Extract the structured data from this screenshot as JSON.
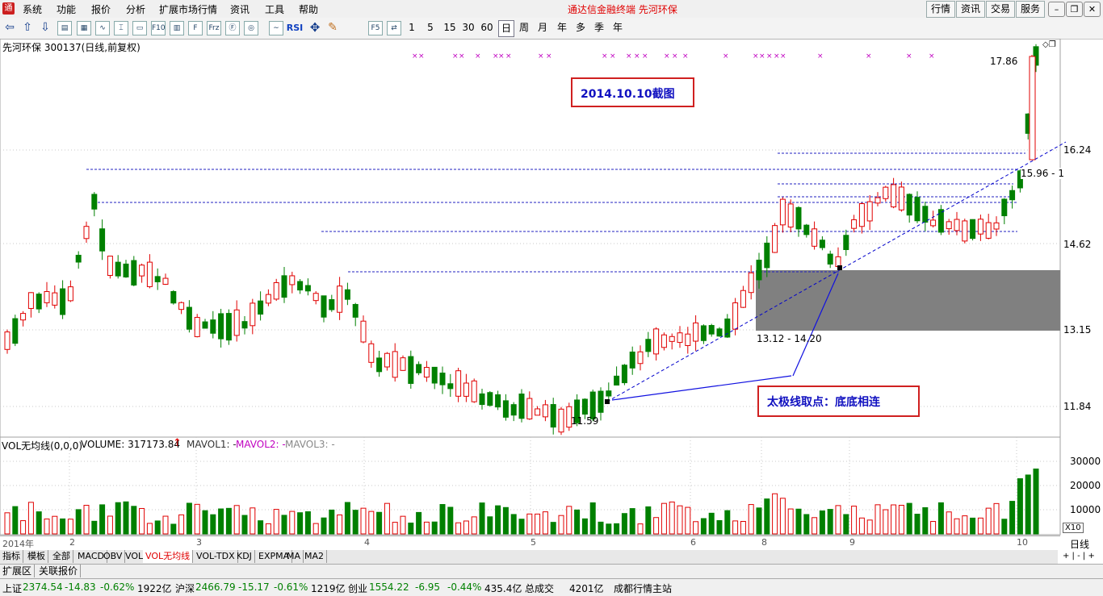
{
  "menubar": {
    "items": [
      "系统",
      "功能",
      "报价",
      "分析",
      "扩展市场行情",
      "资讯",
      "工具",
      "帮助"
    ],
    "center_title": "通达信金融终端    先河环保",
    "right_buttons": [
      "行情",
      "资讯",
      "交易",
      "服务"
    ]
  },
  "toolbar": {
    "periods": [
      "1",
      "5",
      "15",
      "30",
      "60",
      "日",
      "周",
      "月",
      "年",
      "多",
      "季",
      "年"
    ],
    "rsi_label": "RSI"
  },
  "chart": {
    "header": "先河环保 300137(日线,前复权)",
    "annotation_date": "2014.10.10截图",
    "annotation_taiji": "太极线取点：底底相连",
    "range_label": "13.12 - 14.20",
    "partial_label": "15.96 - 1",
    "high_label": "17.86",
    "low_label": "11.59",
    "price_axis": [
      "16.24",
      "14.62",
      "13.15",
      "11.84"
    ],
    "volume_header": {
      "name": "VOL无均线(0,0,0)",
      "volume": "VOLUME: 317173.84",
      "mavol1": "MAVOL1: -",
      "mavol2": "MAVOL2: -",
      "mavol3": "MAVOL3: -"
    },
    "volume_axis": [
      "30000",
      "20000",
      "10000"
    ],
    "volume_unit": "X10",
    "period_label": "日线",
    "time_axis": [
      "2014年",
      "2",
      "3",
      "4",
      "5",
      "6",
      "8",
      "9",
      "10"
    ],
    "colors": {
      "up": "#e00000",
      "down": "#008000",
      "trendline": "#0000cc",
      "box": "#808080"
    }
  },
  "tabs": [
    "指标",
    "模板",
    "全部",
    "MACD",
    "OBV",
    "VOL",
    "VOL无均线",
    "VOL-TDX",
    "KDJ",
    "EXPMA",
    "MA",
    "MA2"
  ],
  "row2": [
    "扩展区",
    "关联报价"
  ],
  "status": {
    "sh_name": "上证",
    "sh_value": "2374.54",
    "sh_change": "-14.83",
    "sh_pct": "-0.62%",
    "sh_amount": "1922亿",
    "sz_name": "沪深",
    "sz_value": "2466.79",
    "sz_change": "-15.17",
    "sz_pct": "-0.61%",
    "sz_amount": "1219亿",
    "cy_name": "创业",
    "cy_value": "1554.22",
    "cy_change": "-6.95",
    "cy_pct": "-0.44%",
    "cy_amount": "435.4亿",
    "total_label": "总成交",
    "total_value": "4201亿",
    "station": "成都行情主站"
  }
}
